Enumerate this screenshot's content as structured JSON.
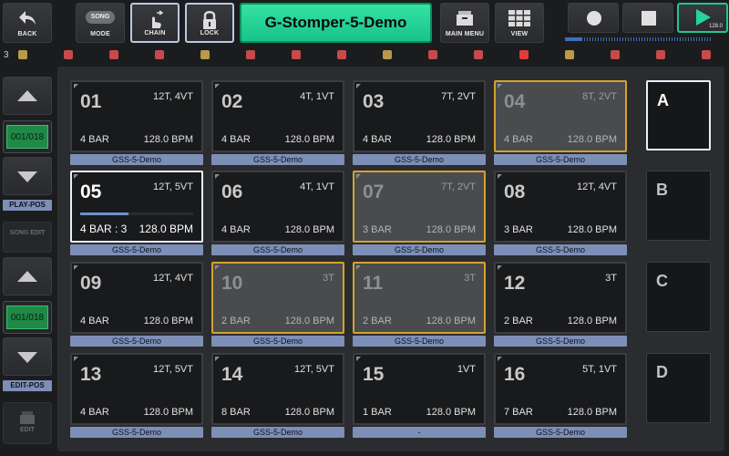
{
  "toolbar": {
    "back_label": "BACK",
    "mode_pill": "SONG",
    "mode_label": "MODE",
    "chain_label": "CHAIN",
    "lock_label": "LOCK",
    "title": "G-Stomper-5-Demo",
    "main_menu_label": "MAIN MENU",
    "view_label": "VIEW",
    "tempo": "128.0",
    "play_progress": 0.42
  },
  "channels": {
    "count": "3",
    "colors": [
      "#b89a4a",
      "#c74a4a",
      "#c74a4a",
      "#c74a4a",
      "#b89a4a",
      "#c74a4a",
      "#c74a4a",
      "#c74a4a",
      "#b89a4a",
      "#c74a4a",
      "#c74a4a",
      "#e23b3b",
      "#b89a4a",
      "#c74a4a",
      "#c74a4a",
      "#c74a4a"
    ]
  },
  "left": {
    "play_pos": "001/018",
    "play_pos_label": "PLAY-POS",
    "song_edit_label": "SONG EDIT",
    "edit_pos": "001/018",
    "edit_pos_label": "EDIT-POS",
    "edit_label": "EDIT"
  },
  "patterns": [
    {
      "num": "01",
      "tracks": "12T, 4VT",
      "bars": "4 BAR",
      "bpm": "128.0 BPM",
      "label": "GSS-5-Demo",
      "state": "normal"
    },
    {
      "num": "02",
      "tracks": "4T, 1VT",
      "bars": "4 BAR",
      "bpm": "128.0 BPM",
      "label": "GSS-5-Demo",
      "state": "normal"
    },
    {
      "num": "03",
      "tracks": "7T, 2VT",
      "bars": "4 BAR",
      "bpm": "128.0 BPM",
      "label": "GSS-5-Demo",
      "state": "normal"
    },
    {
      "num": "04",
      "tracks": "8T, 2VT",
      "bars": "4 BAR",
      "bpm": "128.0 BPM",
      "label": "GSS-5-Demo",
      "state": "queued"
    },
    {
      "num": "05",
      "tracks": "12T, 5VT",
      "bars": "4 BAR : 3",
      "bpm": "128.0 BPM",
      "label": "GSS-5-Demo",
      "state": "played",
      "progress": 0.43
    },
    {
      "num": "06",
      "tracks": "4T, 1VT",
      "bars": "4 BAR",
      "bpm": "128.0 BPM",
      "label": "GSS-5-Demo",
      "state": "normal"
    },
    {
      "num": "07",
      "tracks": "7T, 2VT",
      "bars": "3 BAR",
      "bpm": "128.0 BPM",
      "label": "GSS-5-Demo",
      "state": "queued"
    },
    {
      "num": "08",
      "tracks": "12T, 4VT",
      "bars": "3 BAR",
      "bpm": "128.0 BPM",
      "label": "GSS-5-Demo",
      "state": "normal"
    },
    {
      "num": "09",
      "tracks": "12T, 4VT",
      "bars": "4 BAR",
      "bpm": "128.0 BPM",
      "label": "GSS-5-Demo",
      "state": "normal"
    },
    {
      "num": "10",
      "tracks": "3T",
      "bars": "2 BAR",
      "bpm": "128.0 BPM",
      "label": "GSS-5-Demo",
      "state": "queued"
    },
    {
      "num": "11",
      "tracks": "3T",
      "bars": "2 BAR",
      "bpm": "128.0 BPM",
      "label": "GSS-5-Demo",
      "state": "queued"
    },
    {
      "num": "12",
      "tracks": "3T",
      "bars": "2 BAR",
      "bpm": "128.0 BPM",
      "label": "GSS-5-Demo",
      "state": "normal"
    },
    {
      "num": "13",
      "tracks": "12T, 5VT",
      "bars": "4 BAR",
      "bpm": "128.0 BPM",
      "label": "GSS-5-Demo",
      "state": "normal"
    },
    {
      "num": "14",
      "tracks": "12T, 5VT",
      "bars": "8 BAR",
      "bpm": "128.0 BPM",
      "label": "GSS-5-Demo",
      "state": "normal"
    },
    {
      "num": "15",
      "tracks": "1VT",
      "bars": "1 BAR",
      "bpm": "128.0 BPM",
      "label": "-",
      "state": "normal"
    },
    {
      "num": "16",
      "tracks": "5T, 1VT",
      "bars": "7 BAR",
      "bpm": "128.0 BPM",
      "label": "GSS-5-Demo",
      "state": "normal"
    }
  ],
  "scenes": [
    {
      "label": "A",
      "active": true
    },
    {
      "label": "B",
      "active": false
    },
    {
      "label": "C",
      "active": false
    },
    {
      "label": "D",
      "active": false
    }
  ]
}
